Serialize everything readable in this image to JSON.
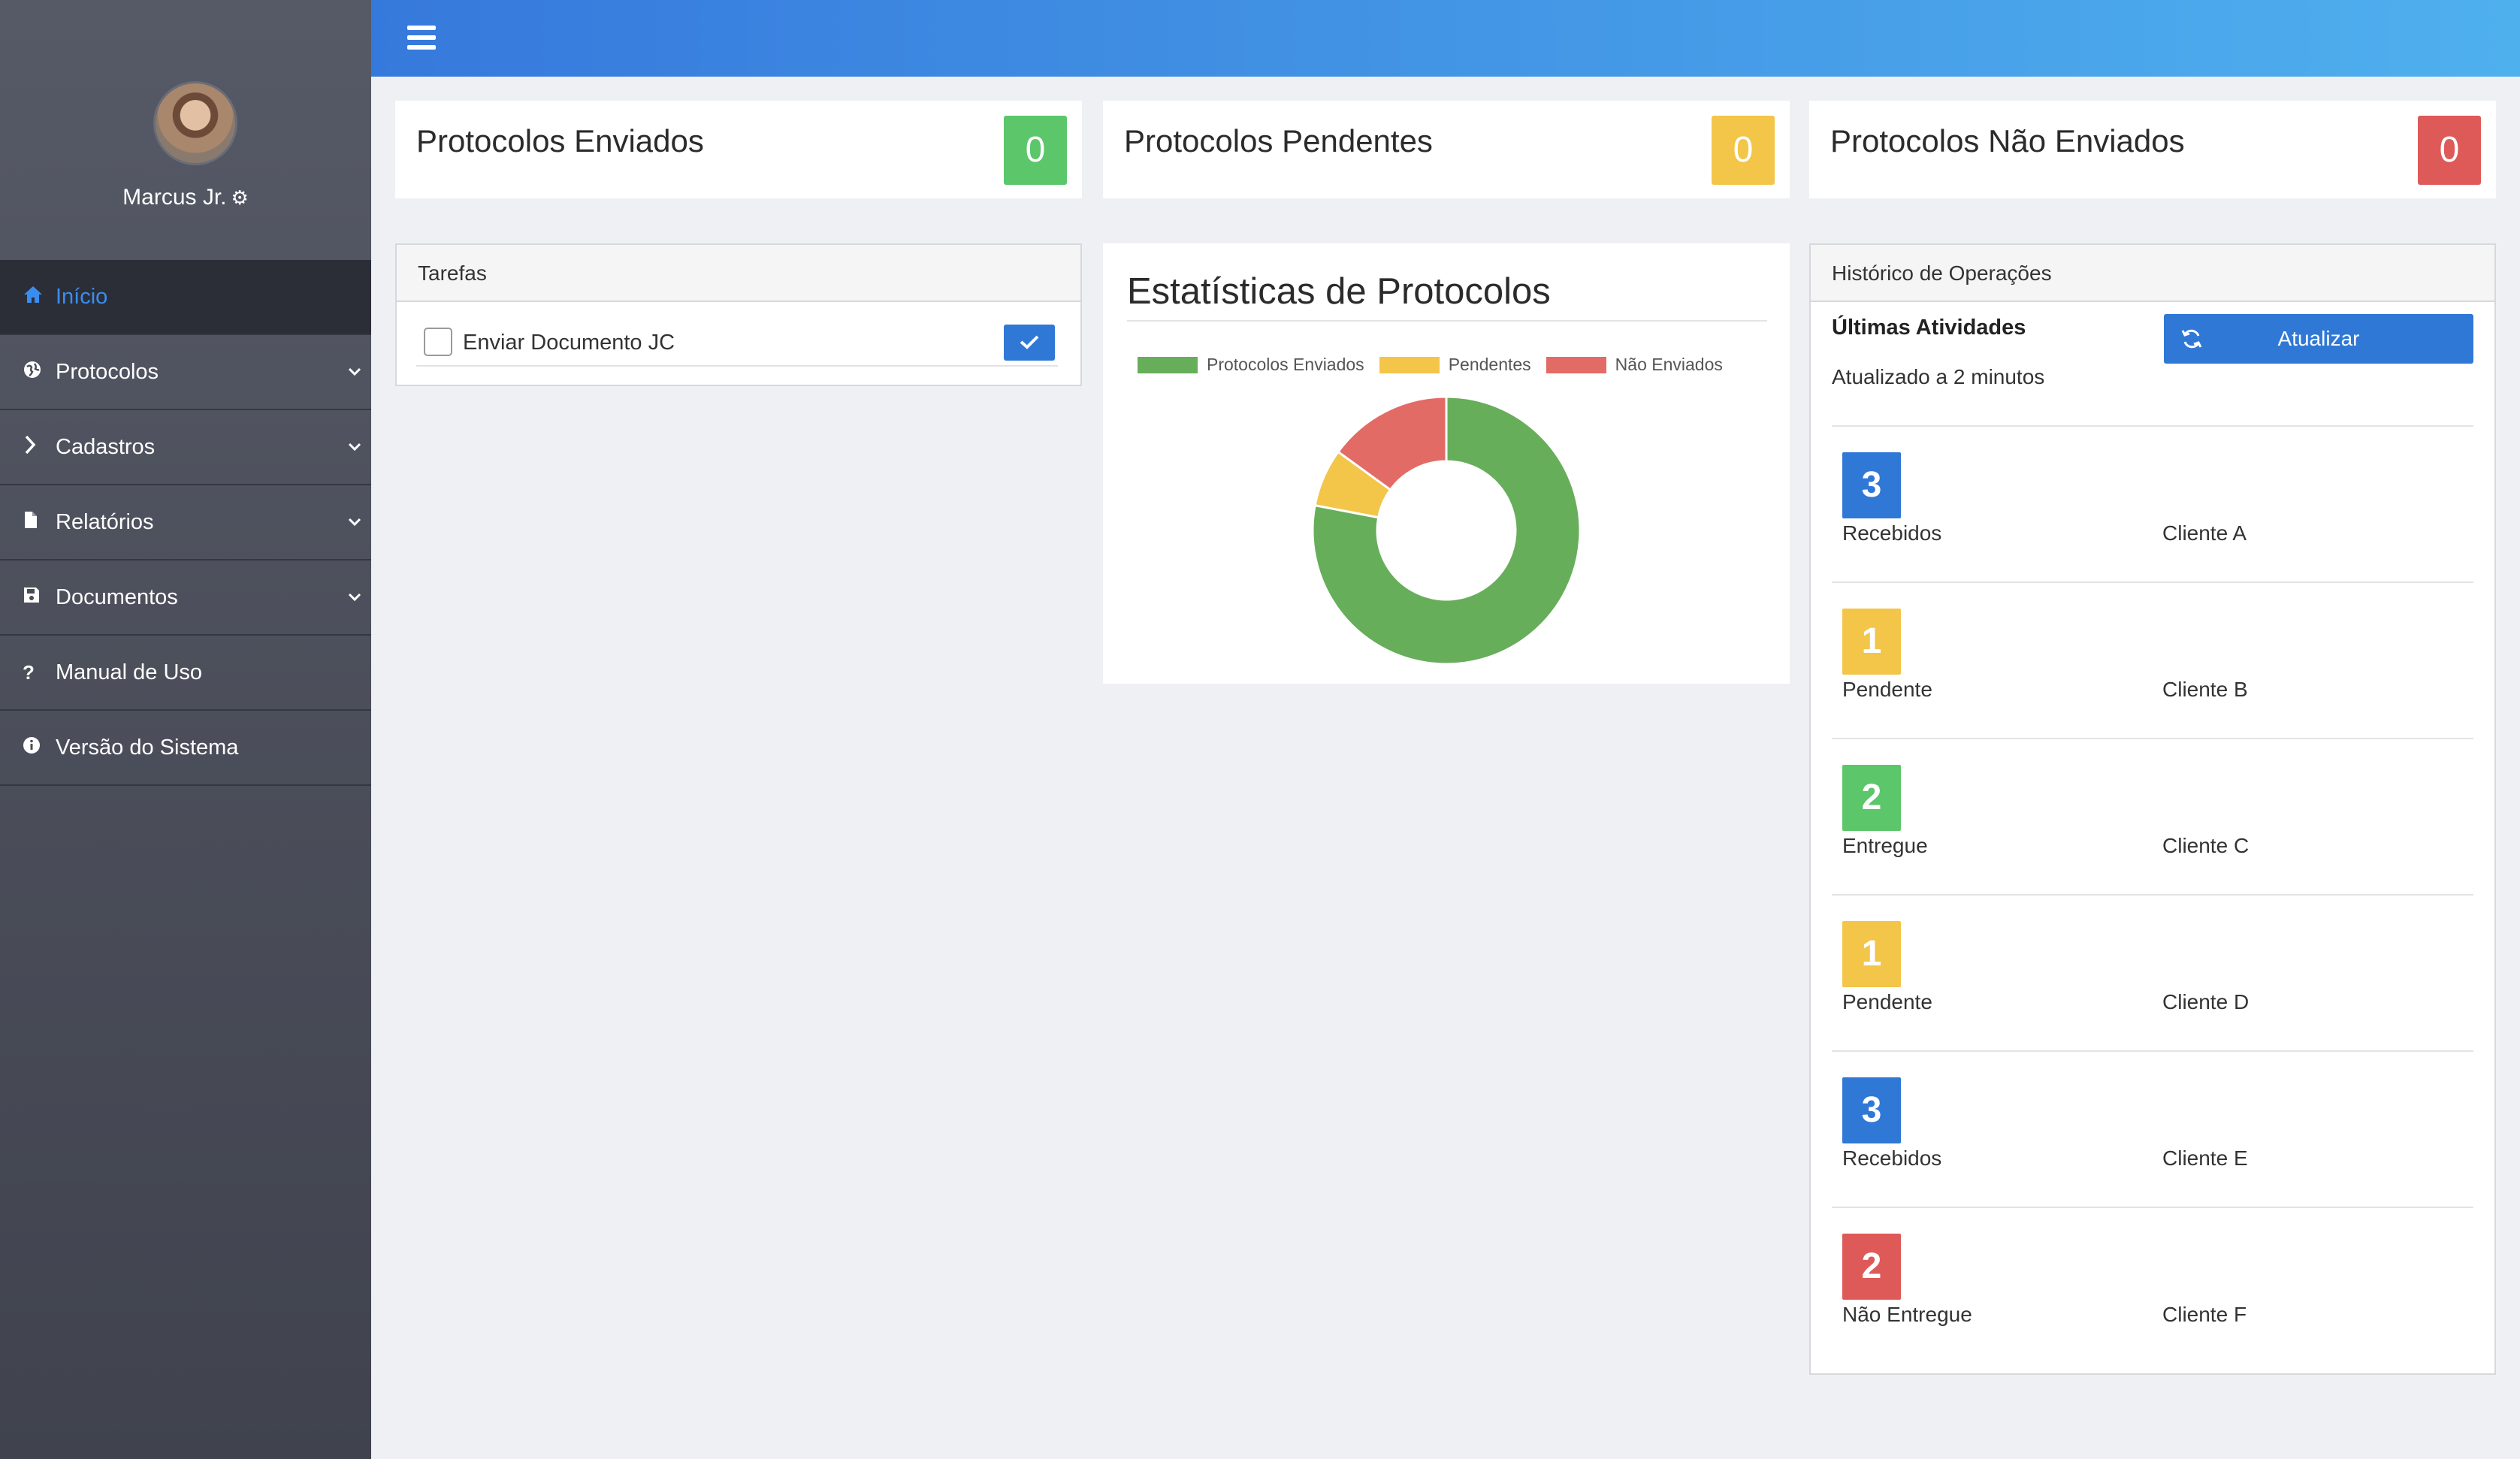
{
  "user": {
    "name": "Marcus Jr."
  },
  "nav": {
    "items": [
      {
        "label": "Início",
        "icon": "home-icon",
        "active": true
      },
      {
        "label": "Protocolos",
        "icon": "globe-icon",
        "expandable": true
      },
      {
        "label": "Cadastros",
        "icon": "chevron-right-icon",
        "expandable": true
      },
      {
        "label": "Relatórios",
        "icon": "file-icon",
        "expandable": true
      },
      {
        "label": "Documentos",
        "icon": "save-icon",
        "expandable": true
      },
      {
        "label": "Manual de Uso",
        "icon": "question-icon"
      },
      {
        "label": "Versão do Sistema",
        "icon": "info-icon"
      }
    ]
  },
  "stats": [
    {
      "label": "Protocolos Enviados",
      "value": "0",
      "color": "#5cc66b"
    },
    {
      "label": "Protocolos Pendentes",
      "value": "0",
      "color": "#f3c549"
    },
    {
      "label": "Protocolos Não Enviados",
      "value": "0",
      "color": "#de5a58"
    }
  ],
  "tasks": {
    "title": "Tarefas",
    "items": [
      {
        "label": "Enviar Documento JC",
        "checked": false
      }
    ]
  },
  "chart": {
    "title": "Estatísticas de Protocolos"
  },
  "chart_data": {
    "type": "pie",
    "title": "Estatísticas de Protocolos",
    "donut": true,
    "categories": [
      "Protocolos Enviados",
      "Pendentes",
      "Não Enviados"
    ],
    "values": [
      78,
      7,
      15
    ],
    "colors": [
      "#67ae5a",
      "#f3c549",
      "#e26b66"
    ],
    "legend": "top"
  },
  "history": {
    "title": "Histórico de Operações",
    "subtitle": "Últimas Atividades",
    "refresh_label": "Atualizar",
    "updated": "Atualizado a 2 minutos",
    "items": [
      {
        "count": "3",
        "status": "Recebidos",
        "client": "Cliente A",
        "color": "#2f78d6"
      },
      {
        "count": "1",
        "status": "Pendente",
        "client": "Cliente B",
        "color": "#f3c549"
      },
      {
        "count": "2",
        "status": "Entregue",
        "client": "Cliente C",
        "color": "#5cc66b"
      },
      {
        "count": "1",
        "status": "Pendente",
        "client": "Cliente D",
        "color": "#f3c549"
      },
      {
        "count": "3",
        "status": "Recebidos",
        "client": "Cliente E",
        "color": "#2f78d6"
      },
      {
        "count": "2",
        "status": "Não Entregue",
        "client": "Cliente F",
        "color": "#de5a58"
      }
    ]
  }
}
